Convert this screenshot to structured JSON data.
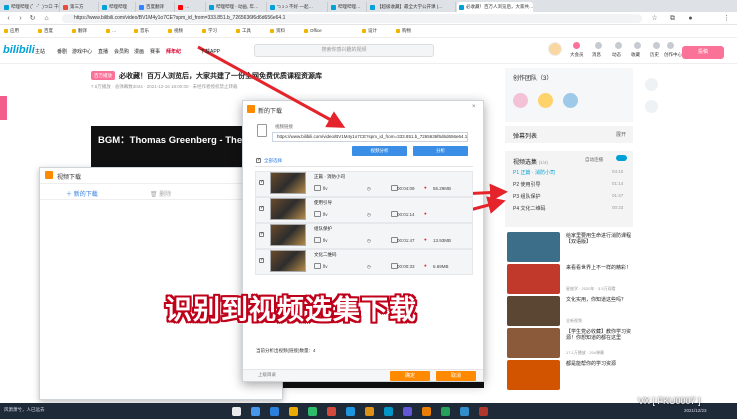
{
  "browser": {
    "tabs": [
      {
        "label": "哔哩哔哩 (゜-゜)つロ 干杯~-bilibili",
        "color": "#00a1d6"
      },
      {
        "label": "第三方",
        "color": "#e74c3c"
      },
      {
        "label": "哔哩哔哩",
        "color": "#00a1d6"
      },
      {
        "label": "百度翻译",
        "color": "#3385ff"
      },
      {
        "label": "…",
        "color": "#ff0000"
      },
      {
        "label": "哔哩哔哩 - 动画, 年…",
        "color": "#00a1d6"
      },
      {
        "label": "“ɔ ɔ ɔ 不好·一起…",
        "color": "#00a1d6"
      },
      {
        "label": "哔哩哔哩…",
        "color": "#00a1d6"
      },
      {
        "label": "【超级收藏】最全大学公开课 (…",
        "color": "#00a1d6"
      },
      {
        "label": "必收藏！百万人浏览后，大家共…",
        "color": "#00a1d6"
      }
    ],
    "url": "https://www.bilibili.com/video/BV1M4y1o7CE?spm_id_from=333.851.b_7265636f6d6d656e64.1",
    "bookmarks": [
      "应用",
      "百度",
      "翻译",
      "…",
      "音乐",
      "视频",
      "学习",
      "工具",
      "资料",
      "Office",
      "设计",
      "购物"
    ]
  },
  "site": {
    "logo": "bilibili",
    "nav": [
      "主站",
      "番剧",
      "游戏中心",
      "直播",
      "会员购",
      "漫画",
      "赛事",
      "拜年纪",
      "下载APP"
    ],
    "search_placeholder": "搜索你感兴趣的视频",
    "right_nav": [
      "大会员",
      "消息",
      "动态",
      "收藏",
      "历史",
      "创作中心"
    ],
    "submit_label": "投稿"
  },
  "video": {
    "badge": "百万播放",
    "title": "必收藏！百万人浏览后，大家共建了一份全网免费优质课程资源库",
    "meta": "7.6万播放 · 总弹幕数3044 · 2021-12-16 18:00:00 · 未经作者授权禁止转载",
    "bgm_text": "BGM：Thomas Greenberg - The Right"
  },
  "sidebar": {
    "team_title": "创作团队（3）",
    "danmaku_label": "弹幕列表",
    "danmaku_more": "展开",
    "episodes_title": "视频选集",
    "episodes_count": "(1/4)",
    "autoplay_label": "自动连播",
    "episodes": [
      {
        "label": "P1  正篇 · 消防小司",
        "time": "04:10",
        "active": true
      },
      {
        "label": "P2  使用引导",
        "time": "01:14",
        "active": false
      },
      {
        "label": "P3  组队保护",
        "time": "01:47",
        "active": false
      },
      {
        "label": "P4  文化二维码",
        "time": "00:33",
        "active": false
      }
    ],
    "recommendations": [
      {
        "title": "给家里要用生命进行消防课程【双语版】",
        "meta": "",
        "color": "#3c6e8a"
      },
      {
        "title": "来看看世界上不一样的精彩！",
        "meta": "星座学 · 2020年 · 3.5万观看",
        "color": "#c0392b"
      },
      {
        "title": "文化实用，你知道这些吗？",
        "meta": "全新视频",
        "color": "#5a4632"
      },
      {
        "title": "【学生党必收藏】教你学习资源！你想知道的都在这里",
        "meta": "17.1万播放 · 204弹幕",
        "color": "#8a5a3a"
      },
      {
        "title": "都是能帮你的学习资源",
        "meta": "",
        "color": "#d35400"
      }
    ]
  },
  "dialog_front": {
    "title": "新的下载",
    "link_label": "视频链接",
    "link_value": "https://www.bilibili.com/video/BV1M4y1o7CE?spm_id_from=333.851.b_7265636f6d6d656e64.1",
    "analyze_label": "视频分析",
    "parse_label": "分析",
    "select_all_label": "全部选择",
    "files": [
      {
        "name": "正篇 · 消防小司",
        "format": "flv",
        "size": "55.29MB",
        "duration": "00:04:09"
      },
      {
        "name": "使用引导",
        "format": "flv",
        "size": "",
        "duration": "00:01:14"
      },
      {
        "name": "组队保护",
        "format": "flv",
        "size": "13.93MB",
        "duration": "00:01:47"
      },
      {
        "name": "文化二维码",
        "format": "flv",
        "size": "6.69MB",
        "duration": "00:00:33"
      }
    ],
    "summary": "当前分析出视频(链接)数量：4",
    "left_label": "上级目录",
    "confirm_label": "确定",
    "cancel_label": "取消"
  },
  "dialog_back": {
    "title": "视频下载",
    "new_download_label": "新的下载",
    "delete_label": "删除"
  },
  "caption": "识别到视频选集下载",
  "taskbar": {
    "text": "风萧萧兮，人已远去",
    "clock": "2021/12/23"
  },
  "watermark": "VX [ FKU0007 ]",
  "colors": {
    "accent_blue": "#00a1d6",
    "accent_pink": "#fb7299",
    "download_orange": "#ff8a00",
    "arrow_red": "#e5232a"
  }
}
